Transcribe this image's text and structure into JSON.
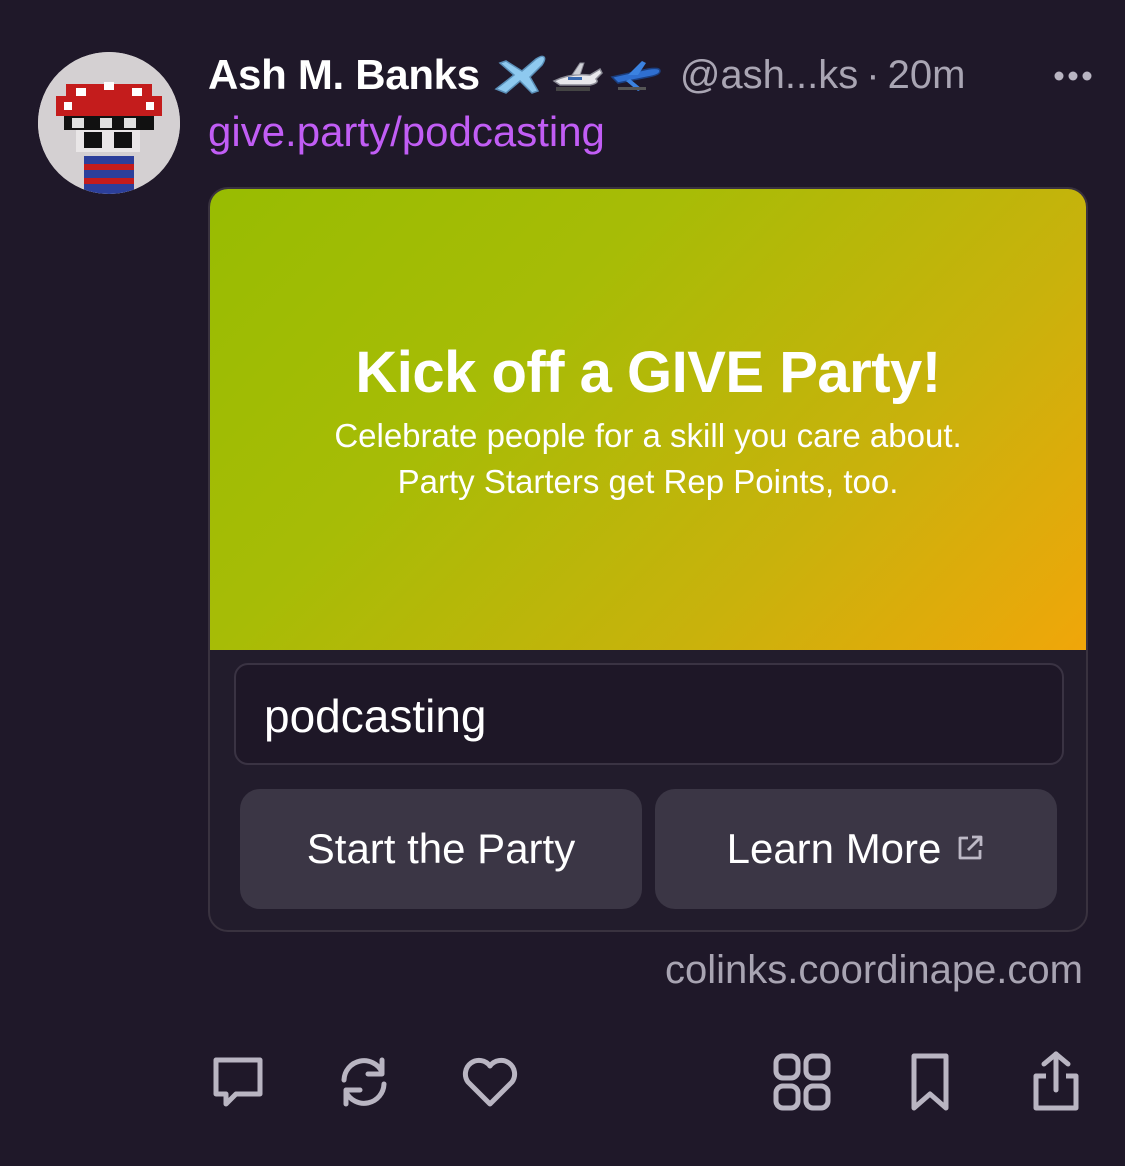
{
  "post": {
    "display_name": "Ash M. Banks",
    "badges": [
      "airplane-icon",
      "jet-icon",
      "plane-icon"
    ],
    "handle": "@ash...ks",
    "separator": "·",
    "time": "20m",
    "link_text": "give.party/podcasting"
  },
  "card": {
    "title": "Kick off a GIVE Party!",
    "subtitle_line1": "Celebrate people for a skill you care about.",
    "subtitle_line2": "Party Starters get Rep Points, too.",
    "input_value": "podcasting",
    "start_button": "Start the Party",
    "learn_button": "Learn More",
    "domain": "colinks.coordinape.com",
    "gradient_colors": [
      "#98bc02",
      "#f0a60a"
    ]
  },
  "actions": [
    "reply-icon",
    "repost-icon",
    "like-icon",
    "apps-grid-icon",
    "bookmark-icon",
    "share-icon"
  ],
  "colors": {
    "background": "#1f1829",
    "link": "#c15df5",
    "muted": "#a9a5b3",
    "button": "#3b3645"
  }
}
